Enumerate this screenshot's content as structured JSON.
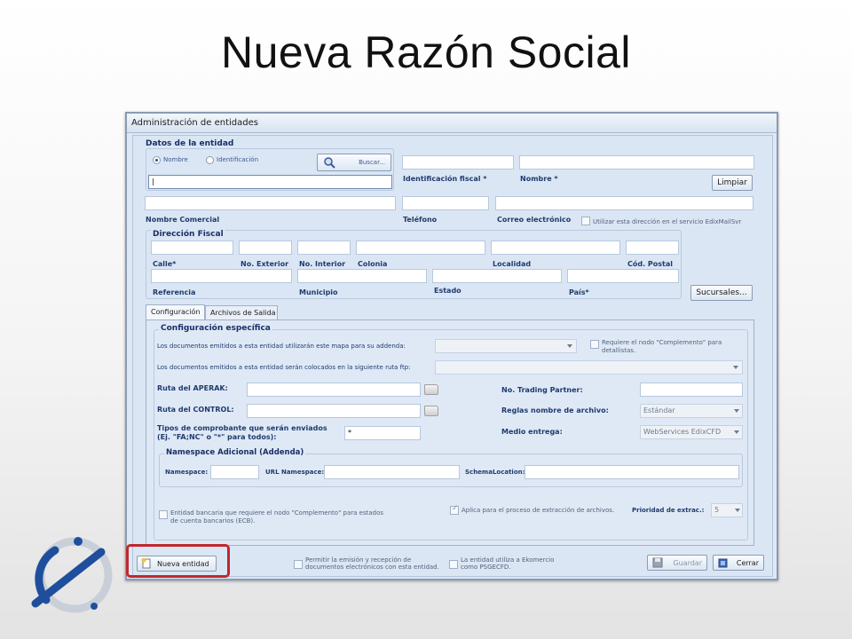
{
  "slide": {
    "title": "Nueva Razón Social"
  },
  "window": {
    "title": "Administración de entidades"
  },
  "datos": {
    "section": "Datos de la entidad",
    "radio_nombre": "Nombre",
    "radio_identificacion": "Identificación",
    "buscar": "Buscar...",
    "name_value": "|",
    "identificacion_fiscal": "Identificación fiscal *",
    "nombre": "Nombre *",
    "limpiar": "Limpiar",
    "nombre_comercial": "Nombre Comercial",
    "telefono": "Teléfono",
    "correo": "Correo electrónico",
    "utilizar_direccion": "Utilizar esta dirección en el servicio EdixMailSvr"
  },
  "direccion": {
    "section": "Dirección Fiscal",
    "calle": "Calle*",
    "no_exterior": "No. Exterior",
    "no_interior": "No. Interior",
    "colonia": "Colonia",
    "localidad": "Localidad",
    "cod_postal": "Cód. Postal",
    "referencia": "Referencia",
    "municipio": "Municipio",
    "estado": "Estado",
    "pais": "País*",
    "sucursales": "Sucursales..."
  },
  "tabs": [
    {
      "label": "Configuración"
    },
    {
      "label": "Archivos de Salida"
    }
  ],
  "config": {
    "section": "Configuración específica",
    "mapa_label": "Los documentos emitidos a esta entidad utilizarán este mapa para su addenda:",
    "requiere_nodo": "Requiere el nodo \"Complemento\" para detallistas.",
    "ruta_ftp_label": "Los documentos emitidos a esta entidad serán colocados en la siguiente ruta ftp:",
    "ruta_aperak": "Ruta del APERAK:",
    "ruta_control": "Ruta del CONTROL:",
    "tipos_label": "Tipos de comprobante que serán enviados (Ej. \"FA;NC\" o \"*\" para todos):",
    "tipos_value": "*",
    "no_trading": "No. Trading Partner:",
    "reglas": "Reglas nombre de archivo:",
    "reglas_value": "Estándar",
    "medio": "Medio entrega:",
    "medio_value": "WebServices EdixCFD"
  },
  "namespace": {
    "section": "Namespace Adicional (Addenda)",
    "namespace": "Namespace:",
    "url_namespace": "URL Namespace:",
    "schema": "SchemaLocation:"
  },
  "bottom": {
    "entidad_bancaria": "Entidad bancaria que requiere el nodo \"Complemento\" para estados de cuenta bancarios (ECB).",
    "aplica": "Aplica para el proceso de extracción de archivos.",
    "prioridad": "Prioridad de extrac.:",
    "prioridad_value": "5"
  },
  "footer": {
    "nueva_entidad": "Nueva entidad",
    "permitir": "Permitir la emisión y recepción de documentos electrónicos con esta entidad.",
    "ekomercio": "La entidad utiliza a Ekomercio como PSGECFD.",
    "guardar": "Guardar",
    "cerrar": "Cerrar"
  },
  "colors": {
    "highlight": "#c0282d",
    "label": "#1f3b6e",
    "window_bg": "#dbe6f4"
  }
}
